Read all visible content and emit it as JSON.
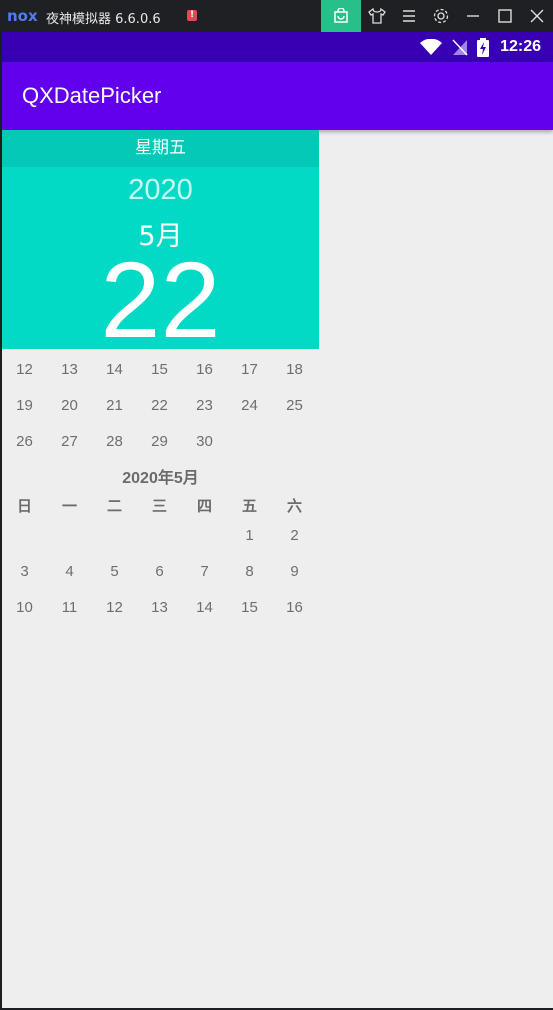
{
  "emulator": {
    "logo": "nox",
    "title": "夜神模拟器 6.6.0.6",
    "alert": "!",
    "controls": [
      "store-icon",
      "shirt-icon",
      "menu-icon",
      "gear-icon",
      "minimize-icon",
      "maximize-icon",
      "close-icon"
    ]
  },
  "status_bar": {
    "time": "12:26"
  },
  "app_bar": {
    "title": "QXDatePicker"
  },
  "date_header": {
    "weekday": "星期五",
    "year": "2020",
    "month": "5月",
    "day": "22"
  },
  "prev_weeks": [
    [
      "12",
      "13",
      "14",
      "15",
      "16",
      "17",
      "18"
    ],
    [
      "19",
      "20",
      "21",
      "22",
      "23",
      "24",
      "25"
    ],
    [
      "26",
      "27",
      "28",
      "29",
      "30",
      "",
      ""
    ]
  ],
  "calendar": {
    "title": "2020年5月",
    "weekdays": [
      "日",
      "一",
      "二",
      "三",
      "四",
      "五",
      "六"
    ],
    "weeks": [
      [
        "",
        "",
        "",
        "",
        "",
        "1",
        "2"
      ],
      [
        "3",
        "4",
        "5",
        "6",
        "7",
        "8",
        "9"
      ],
      [
        "10",
        "11",
        "12",
        "13",
        "14",
        "15",
        "16"
      ]
    ]
  },
  "colors": {
    "status_bar": "#3700b3",
    "app_bar": "#6200ee",
    "header_accent": "#03dac5",
    "emulator_store": "#27c08a"
  }
}
